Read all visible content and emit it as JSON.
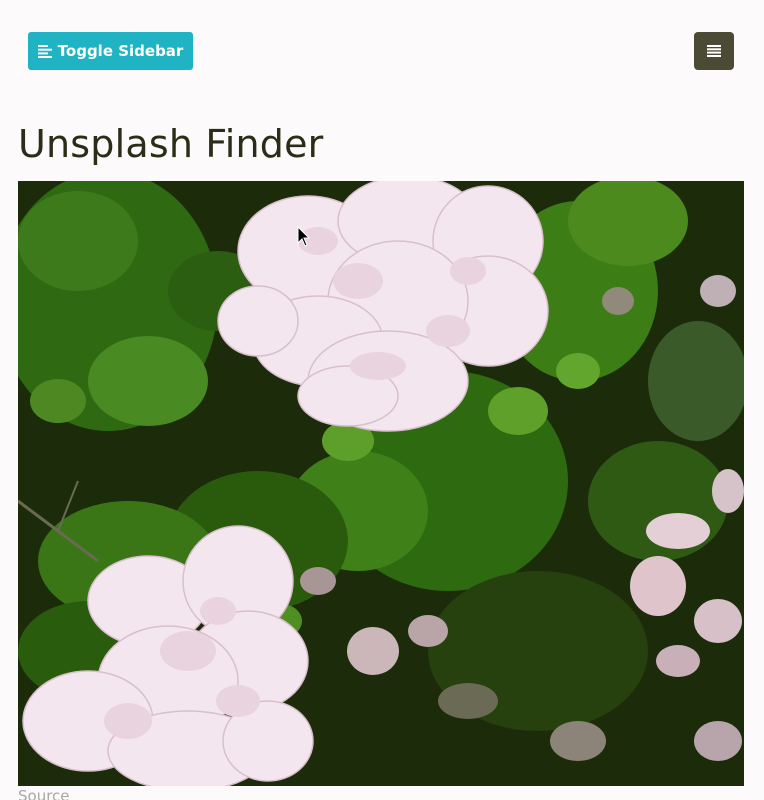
{
  "header": {
    "toggle_sidebar_label": "Toggle Sidebar",
    "toggle_icon": "align-left-icon",
    "menu_icon": "hamburger-menu-icon"
  },
  "main": {
    "title": "Unsplash Finder",
    "photo_alt": "Pink roses in a garden",
    "source_label": "Source"
  },
  "colors": {
    "accent": "#1fb3c4",
    "menu_button": "#4b4a35",
    "title": "#2a2d17",
    "muted": "#a8a8a8",
    "background": "#fdfafb"
  }
}
